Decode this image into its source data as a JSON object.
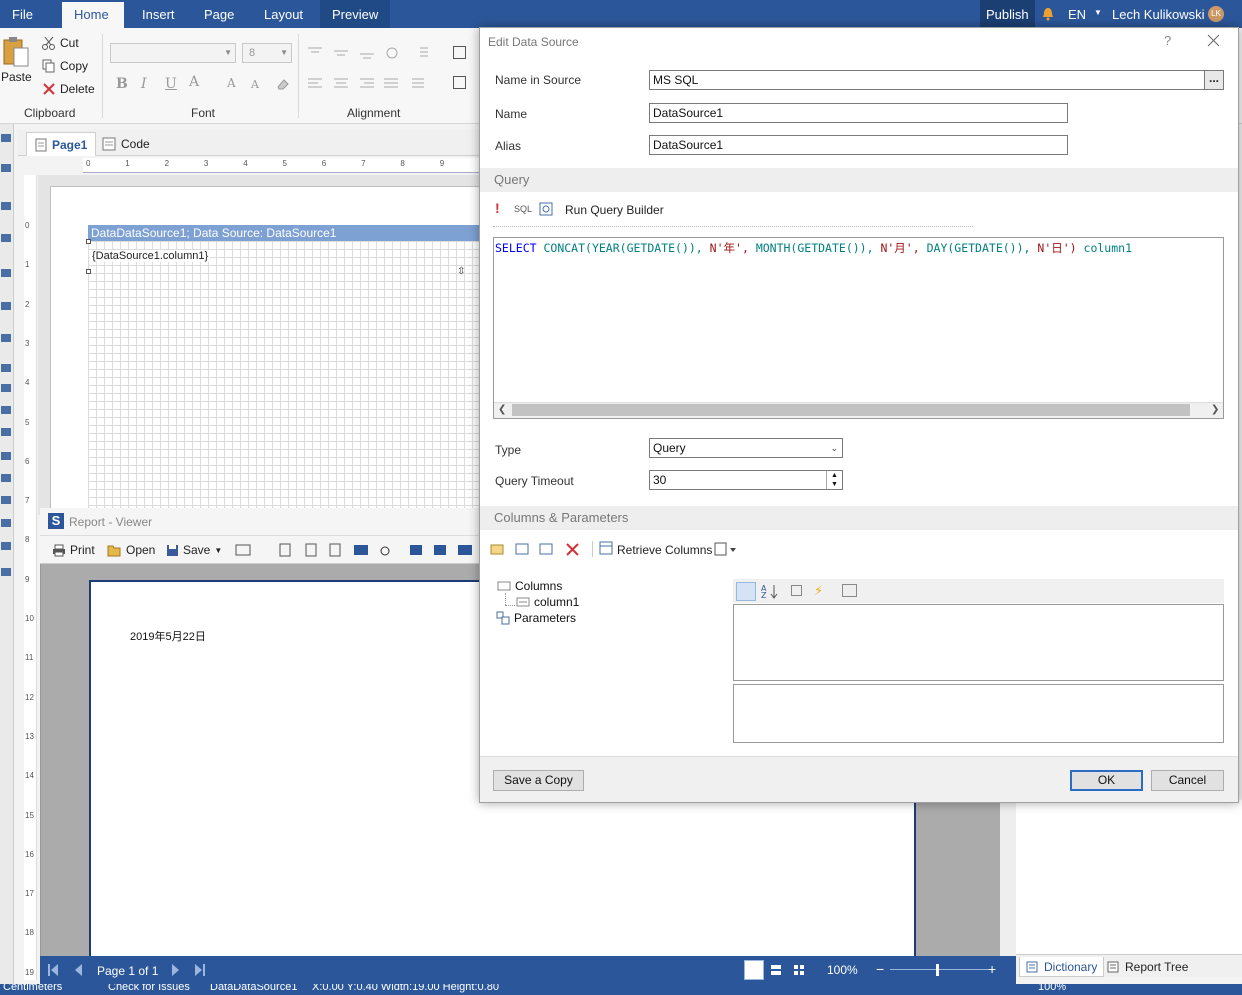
{
  "ribbon": {
    "tabs": [
      "File",
      "Home",
      "Insert",
      "Page",
      "Layout",
      "Preview"
    ],
    "active_tab": "Home",
    "publish_label": "Publish",
    "language": "EN",
    "user_name": "Lech Kulikowski",
    "user_initials": "LK",
    "clipboard": {
      "paste": "Paste",
      "cut": "Cut",
      "copy": "Copy",
      "delete": "Delete",
      "group_label": "Clipboard"
    },
    "font": {
      "group_label": "Font",
      "size_value": "8"
    },
    "alignment": {
      "group_label": "Alignment"
    }
  },
  "designer": {
    "page_tab": "Page1",
    "code_tab": "Code",
    "hruler_ticks": [
      "0",
      "1",
      "2",
      "3",
      "4",
      "5",
      "6",
      "7",
      "8",
      "9"
    ],
    "vruler_ticks": [
      "0",
      "1",
      "2",
      "3",
      "4",
      "5",
      "6",
      "7",
      "8",
      "9",
      "10",
      "11",
      "12",
      "13",
      "14",
      "15",
      "16",
      "17",
      "18",
      "19"
    ],
    "band_header": "DataDataSource1; Data Source: DataSource1",
    "field_text": "{DataSource1.column1}"
  },
  "viewer": {
    "title": "Report - Viewer",
    "toolbar": {
      "print": "Print",
      "open": "Open",
      "save": "Save"
    },
    "content_text": "2019年5月22日",
    "page_info": "Page 1 of 1",
    "zoom": "100%"
  },
  "dialog": {
    "title": "Edit Data Source",
    "name_in_source_label": "Name in Source",
    "name_in_source_value": "MS SQL",
    "browse_label": "...",
    "name_label": "Name",
    "name_value": "DataSource1",
    "alias_label": "Alias",
    "alias_value": "DataSource1",
    "query_section": "Query",
    "sql_label": "SQL",
    "run_query_builder": "Run Query Builder",
    "sql_parts": [
      {
        "t": "SELECT",
        "c": "#0000ff"
      },
      {
        "t": " ",
        "c": "#000000"
      },
      {
        "t": "CONCAT(YEAR(GETDATE()),",
        "c": "#008080"
      },
      {
        "t": " ",
        "c": "#000000"
      },
      {
        "t": "N'年',",
        "c": "#a31515"
      },
      {
        "t": " ",
        "c": "#000000"
      },
      {
        "t": "MONTH(GETDATE()),",
        "c": "#008080"
      },
      {
        "t": " ",
        "c": "#000000"
      },
      {
        "t": "N'月',",
        "c": "#a31515"
      },
      {
        "t": " ",
        "c": "#000000"
      },
      {
        "t": "DAY(GETDATE()),",
        "c": "#008080"
      },
      {
        "t": " ",
        "c": "#000000"
      },
      {
        "t": "N'日')",
        "c": "#a31515"
      },
      {
        "t": " ",
        "c": "#000000"
      },
      {
        "t": "column1",
        "c": "#008080"
      }
    ],
    "type_label": "Type",
    "type_value": "Query",
    "timeout_label": "Query Timeout",
    "timeout_value": "30",
    "columns_section": "Columns & Parameters",
    "retrieve_columns": "Retrieve Columns",
    "tree_columns": "Columns",
    "tree_column1": "column1",
    "tree_parameters": "Parameters",
    "save_copy": "Save a Copy",
    "ok": "OK",
    "cancel": "Cancel",
    "help": "?"
  },
  "dictionary": {
    "tab_dictionary": "Dictionary",
    "tab_report_tree": "Report Tree",
    "zoom": "100%"
  },
  "statusbar": {
    "units": "Centimeters",
    "check_issues": "Check for Issues",
    "component": "DataDataSource1",
    "coords": "X:0.00  Y:0.40  Width:19.00  Height:0.80"
  },
  "colors": {
    "accent": "#2b579a",
    "band": "#7ea1d4",
    "error": "#d13438"
  }
}
